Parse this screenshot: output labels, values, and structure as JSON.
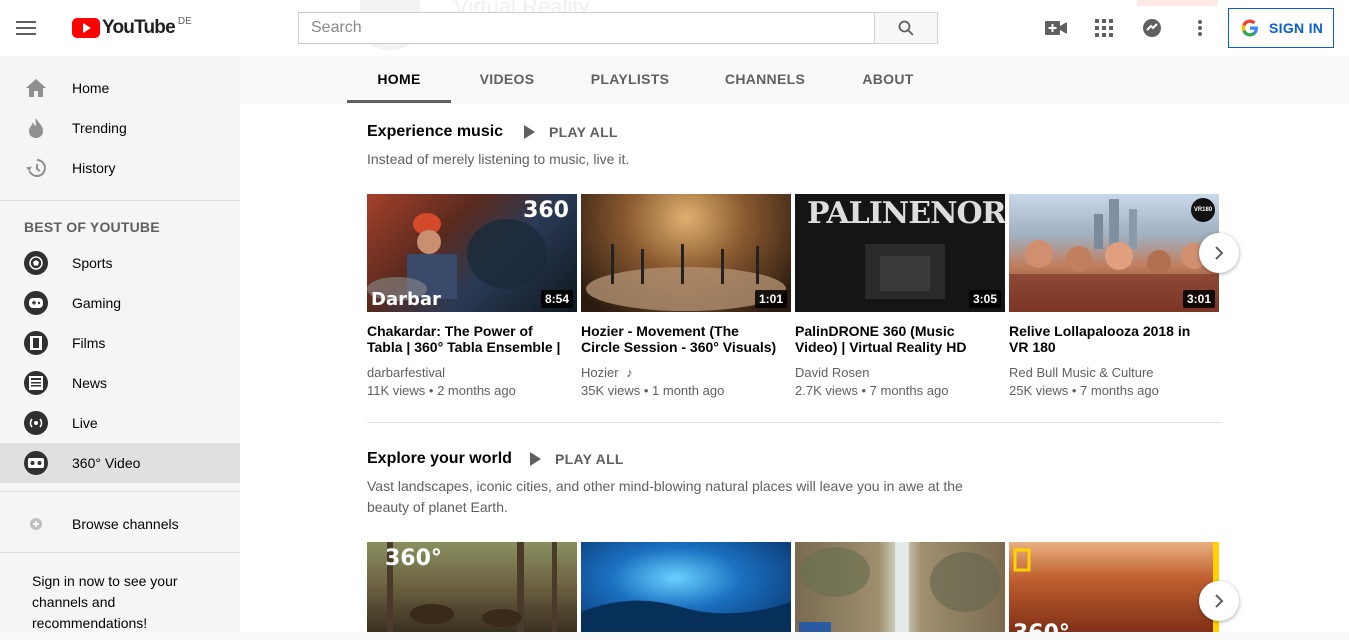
{
  "header": {
    "logo_text": "YouTube",
    "country_code": "DE",
    "search_placeholder": "Search",
    "sign_in_label": "SIGN IN",
    "banner_ghost_text": "Virtual Reality"
  },
  "sidebar": {
    "main_items": [
      {
        "label": "Home",
        "icon": "home-icon"
      },
      {
        "label": "Trending",
        "icon": "trending-icon"
      },
      {
        "label": "History",
        "icon": "history-icon"
      }
    ],
    "section_title": "BEST OF YOUTUBE",
    "best_items": [
      {
        "label": "Sports",
        "icon": "sports-icon"
      },
      {
        "label": "Gaming",
        "icon": "gaming-icon"
      },
      {
        "label": "Films",
        "icon": "films-icon"
      },
      {
        "label": "News",
        "icon": "news-icon"
      },
      {
        "label": "Live",
        "icon": "live-icon"
      },
      {
        "label": "360° Video",
        "icon": "vr-icon",
        "active": true
      }
    ],
    "browse_label": "Browse channels",
    "signin_note": "Sign in now to see your channels and recommendations!"
  },
  "tabs": [
    "HOME",
    "VIDEOS",
    "PLAYLISTS",
    "CHANNELS",
    "ABOUT"
  ],
  "active_tab": "HOME",
  "shelves": [
    {
      "title": "Experience music",
      "play_all": "PLAY ALL",
      "description": "Instead of merely listening to music, live it.",
      "videos": [
        {
          "title": "Chakardar: The Power of Tabla | 360° Tabla Ensemble |",
          "channel": "darbarfestival",
          "views": "11K views",
          "age": "2 months ago",
          "duration": "8:54",
          "overlay_top": "360",
          "overlay_bottom": "Darbar"
        },
        {
          "title": "Hozier - Movement (The Circle Session - 360° Visuals)",
          "channel": "Hozier",
          "channel_badge": "♪",
          "views": "35K views",
          "age": "1 month ago",
          "duration": "1:01"
        },
        {
          "title": "PalinDRONE 360 (Music Video) | Virtual Reality HD",
          "channel": "David Rosen",
          "views": "2.7K views",
          "age": "7 months ago",
          "duration": "3:05",
          "overlay_top": "PALINENORD"
        },
        {
          "title": "Relive Lollapalooza 2018 in VR 180",
          "channel": "Red Bull Music & Culture",
          "views": "25K views",
          "age": "7 months ago",
          "duration": "3:01",
          "overlay_top": "VR180"
        }
      ]
    },
    {
      "title": "Explore your world",
      "play_all": "PLAY ALL",
      "description": "Vast landscapes, iconic cities, and other mind-blowing natural places will leave you in awe at the beauty of planet Earth.",
      "videos": [
        {
          "overlay_top": "360°"
        },
        {},
        {},
        {
          "overlay_top": "360°"
        }
      ]
    }
  ],
  "colors": {
    "brand_red": "#ff0000",
    "link_blue": "#065fd4",
    "sidebar_bg": "#f5f5f5",
    "active_bg": "#e0e0e0"
  }
}
